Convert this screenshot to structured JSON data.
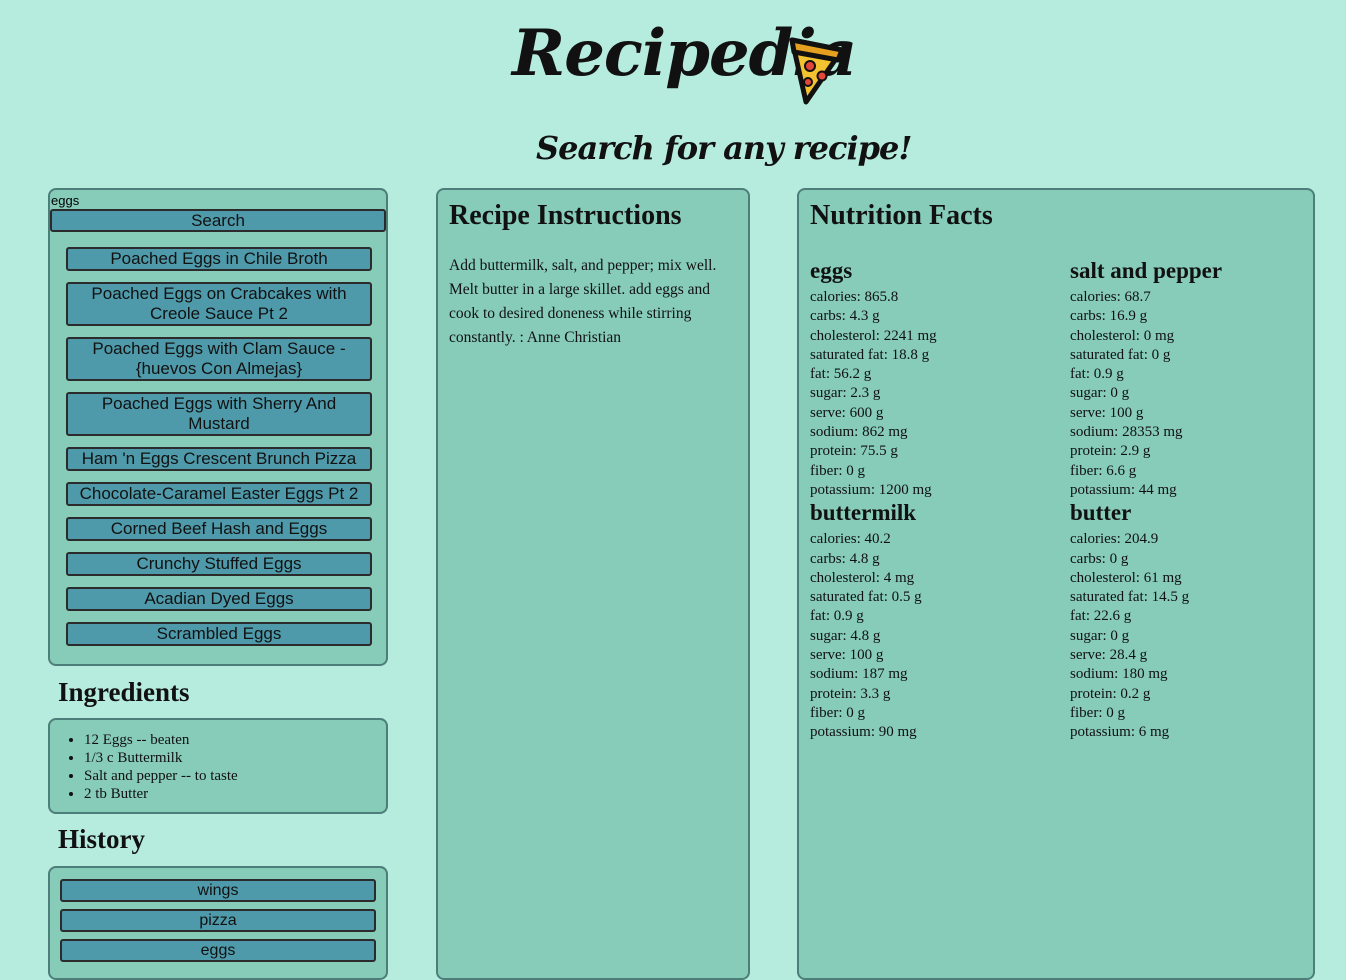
{
  "header": {
    "title": "Recipedia",
    "subtitle": "Search for any recipe!"
  },
  "search": {
    "query": "eggs",
    "button_label": "Search",
    "results": [
      "Poached Eggs in Chile Broth",
      "Poached Eggs on Crabcakes with Creole Sauce Pt 2",
      "Poached Eggs with Clam Sauce - {huevos Con Almejas}",
      "Poached Eggs with Sherry And Mustard",
      "Ham 'n Eggs Crescent Brunch Pizza",
      "Chocolate-Caramel Easter Eggs Pt 2",
      "Corned Beef Hash and Eggs",
      "Crunchy Stuffed Eggs",
      "Acadian Dyed Eggs",
      "Scrambled Eggs"
    ]
  },
  "ingredients": {
    "heading": "Ingredients",
    "items": [
      "12 Eggs -- beaten",
      "1/3 c Buttermilk",
      "Salt and pepper -- to taste",
      "2 tb Butter"
    ]
  },
  "history": {
    "heading": "History",
    "items": [
      "wings",
      "pizza",
      "eggs"
    ]
  },
  "instructions": {
    "heading": "Recipe Instructions",
    "text": "Add buttermilk, salt, and pepper; mix well. Melt butter in a large skillet. add eggs and cook to desired doneness while stirring constantly. : Anne Christian"
  },
  "nutrition": {
    "heading": "Nutrition Facts",
    "items": [
      {
        "name": "eggs",
        "facts": [
          "calories: 865.8",
          "carbs: 4.3 g",
          "cholesterol: 2241 mg",
          "saturated fat: 18.8 g",
          "fat: 56.2 g",
          "sugar: 2.3 g",
          "serve: 600 g",
          "sodium: 862 mg",
          "protein: 75.5 g",
          "fiber: 0 g",
          "potassium: 1200 mg"
        ]
      },
      {
        "name": "salt and pepper",
        "facts": [
          "calories: 68.7",
          "carbs: 16.9 g",
          "cholesterol: 0 mg",
          "saturated fat: 0 g",
          "fat: 0.9 g",
          "sugar: 0 g",
          "serve: 100 g",
          "sodium: 28353 mg",
          "protein: 2.9 g",
          "fiber: 6.6 g",
          "potassium: 44 mg"
        ]
      },
      {
        "name": "buttermilk",
        "facts": [
          "calories: 40.2",
          "carbs: 4.8 g",
          "cholesterol: 4 mg",
          "saturated fat: 0.5 g",
          "fat: 0.9 g",
          "sugar: 4.8 g",
          "serve: 100 g",
          "sodium: 187 mg",
          "protein: 3.3 g",
          "fiber: 0 g",
          "potassium: 90 mg"
        ]
      },
      {
        "name": "butter",
        "facts": [
          "calories: 204.9",
          "carbs: 0 g",
          "cholesterol: 61 mg",
          "saturated fat: 14.5 g",
          "fat: 22.6 g",
          "sugar: 0 g",
          "serve: 28.4 g",
          "sodium: 180 mg",
          "protein: 0.2 g",
          "fiber: 0 g",
          "potassium: 6 mg"
        ]
      }
    ]
  },
  "icons": {
    "logo": "pizza-slice-icon"
  },
  "colors": {
    "background": "#b6ecde",
    "panel": "#86ccb8",
    "panel_border": "#4e7e7a",
    "button": "#4e9aaa"
  }
}
